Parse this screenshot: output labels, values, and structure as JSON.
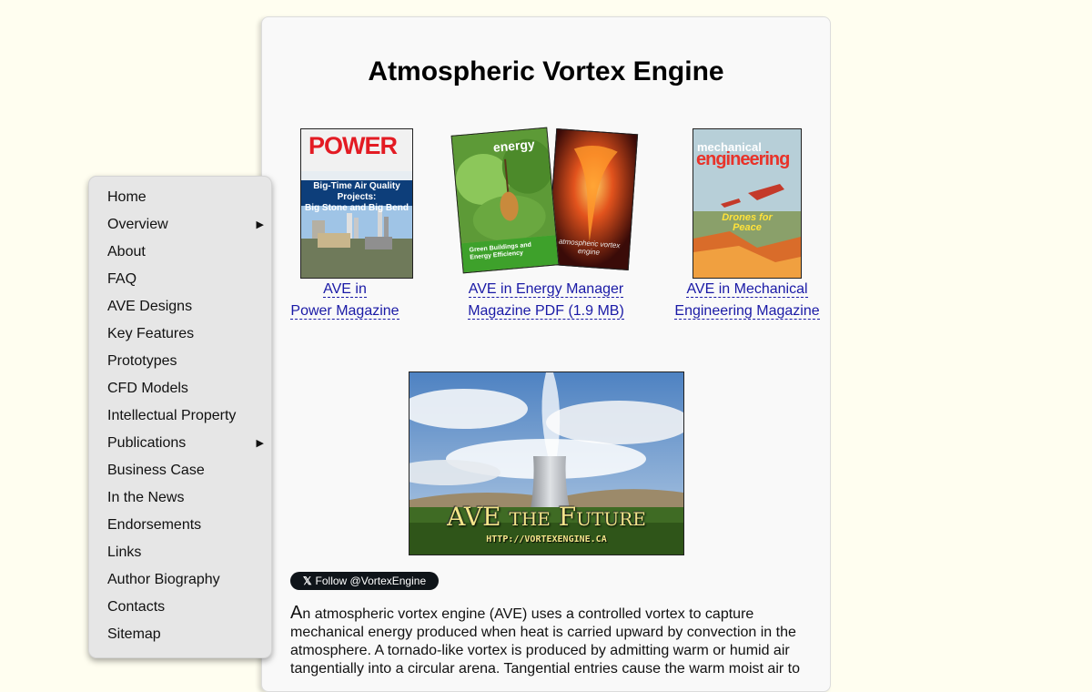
{
  "page": {
    "title": "Atmospheric Vortex Engine"
  },
  "publications": [
    {
      "cover": {
        "masthead": "POWER",
        "headline_1": "Big-Time Air Quality Projects:",
        "headline_2": "Big Stone and Big Bend"
      },
      "link_line1": "AVE in",
      "link_line2": "Power Magazine"
    },
    {
      "cover": {
        "masthead": "energy",
        "footer": "Green Buildings and Energy Efficiency",
        "second_title": "atmospheric vortex engine"
      },
      "link_line1": "AVE in Energy Manager",
      "link_line2": "Magazine PDF (1.9 MB)"
    },
    {
      "cover": {
        "masthead_1": "mechanical",
        "masthead_2": "engineering",
        "headline_1": "Drones for",
        "headline_2": "Peace"
      },
      "link_line1": "AVE in Mechanical",
      "link_line2": "Engineering Magazine"
    }
  ],
  "banner": {
    "title": "AVE the Future",
    "url": "HTTP://VORTEXENGINE.CA"
  },
  "follow_button": {
    "label": "Follow @VortexEngine",
    "icon": "x-logo-icon"
  },
  "intro": {
    "dropcap": "A",
    "text": "n atmospheric vortex engine (AVE) uses a controlled vortex to capture mechanical energy produced when heat is carried upward by convection in the atmosphere. A tornado-like vortex is produced by admitting warm or humid air tangentially into a circular arena. Tangential entries cause the warm moist air to"
  },
  "nav": [
    {
      "label": "Home"
    },
    {
      "label": "Overview",
      "submenu": true
    },
    {
      "label": "About"
    },
    {
      "label": "FAQ"
    },
    {
      "label": "AVE Designs"
    },
    {
      "label": "Key Features"
    },
    {
      "label": "Prototypes"
    },
    {
      "label": "CFD Models"
    },
    {
      "label": "Intellectual Property"
    },
    {
      "label": "Publications",
      "submenu": true
    },
    {
      "label": "Business Case"
    },
    {
      "label": "In the News"
    },
    {
      "label": "Endorsements"
    },
    {
      "label": "Links"
    },
    {
      "label": "Author Biography"
    },
    {
      "label": "Contacts"
    },
    {
      "label": "Sitemap"
    }
  ],
  "colors": {
    "page_bg": "#fffef0",
    "content_bg": "#f9f9f9",
    "sidebar_bg": "#e6e6e6",
    "link": "#1a1aa6",
    "power_red": "#e31b23"
  }
}
